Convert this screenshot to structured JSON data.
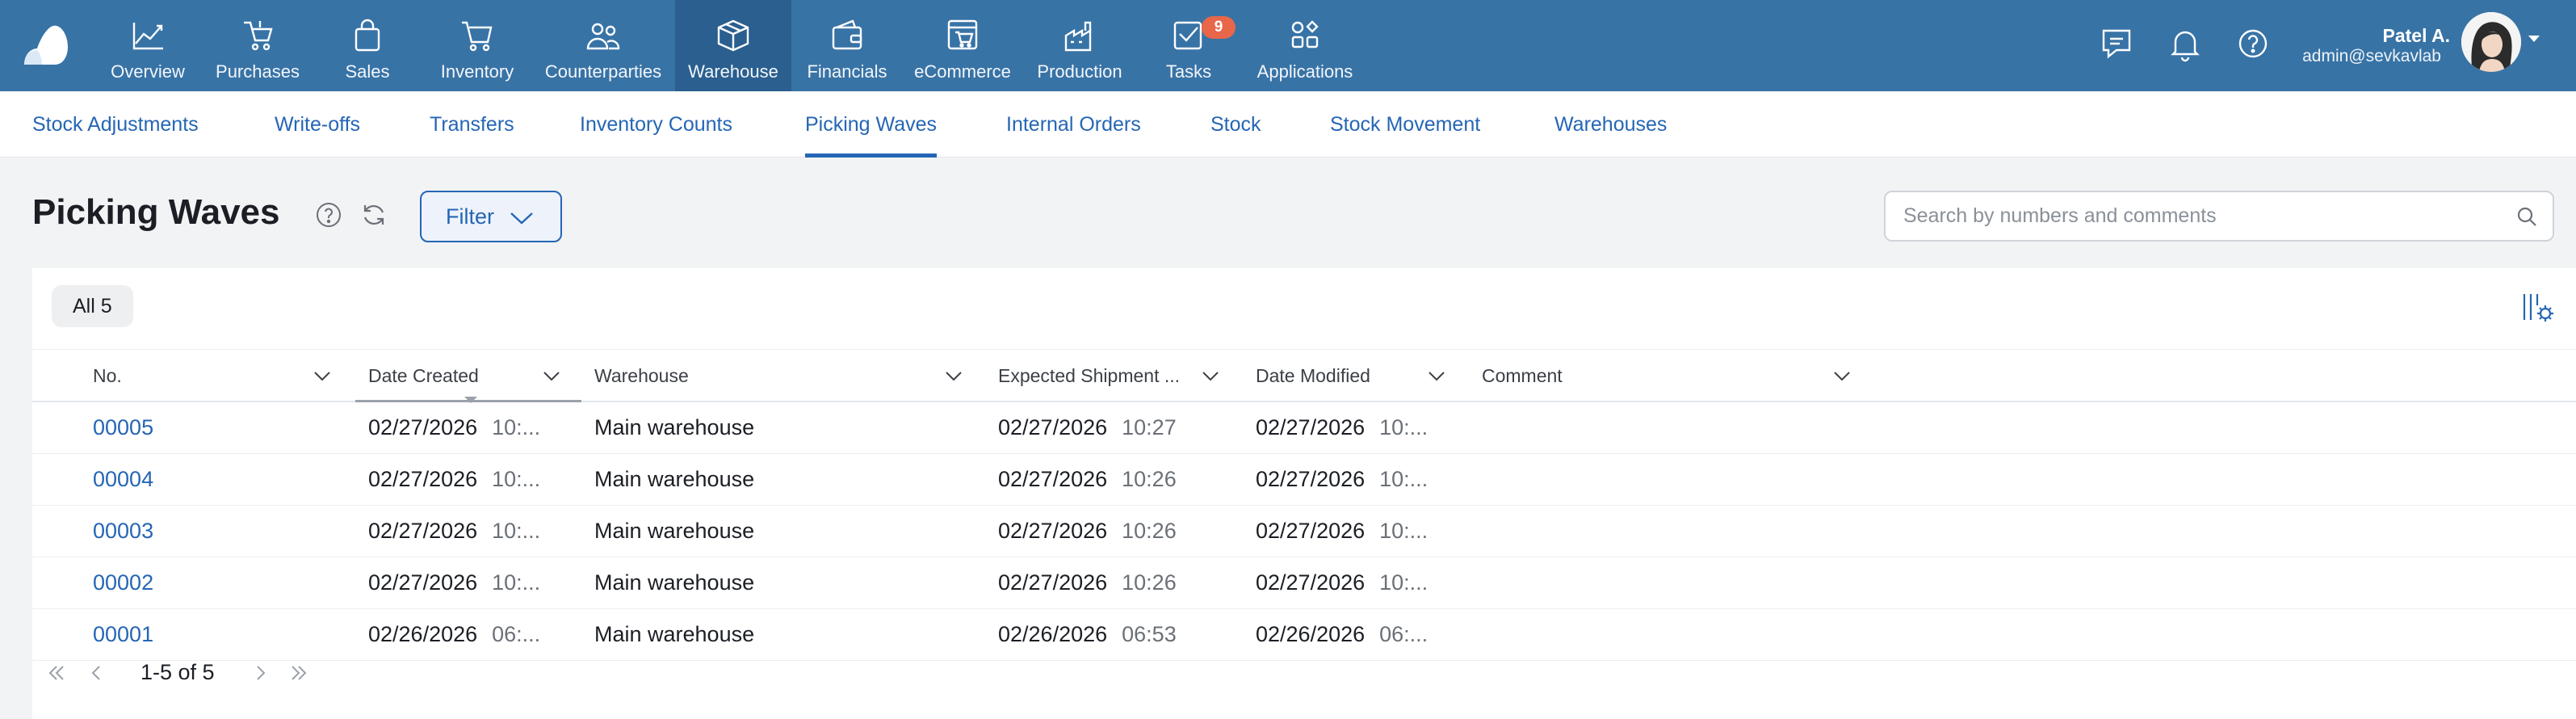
{
  "nav": {
    "items": [
      {
        "label": "Overview",
        "icon": "chart-line-icon"
      },
      {
        "label": "Purchases",
        "icon": "basket-icon"
      },
      {
        "label": "Sales",
        "icon": "shopping-bag-icon"
      },
      {
        "label": "Inventory",
        "icon": "cart-icon"
      },
      {
        "label": "Counterparties",
        "icon": "people-icon"
      },
      {
        "label": "Warehouse",
        "icon": "box-icon",
        "active": true
      },
      {
        "label": "Financials",
        "icon": "wallet-icon"
      },
      {
        "label": "eCommerce",
        "icon": "store-icon"
      },
      {
        "label": "Production",
        "icon": "factory-icon"
      },
      {
        "label": "Tasks",
        "icon": "checkbox-icon",
        "badge": "9"
      },
      {
        "label": "Applications",
        "icon": "apps-icon"
      }
    ],
    "accent_color": "#3873a6",
    "badge_color": "#e8664a"
  },
  "user": {
    "name": "Patel A.",
    "email": "admin@sevkavlab"
  },
  "subnav": {
    "tabs": [
      {
        "label": "Stock Adjustments"
      },
      {
        "label": "Write-offs"
      },
      {
        "label": "Transfers"
      },
      {
        "label": "Inventory Counts"
      },
      {
        "label": "Picking Waves",
        "active": true
      },
      {
        "label": "Internal Orders"
      },
      {
        "label": "Stock"
      },
      {
        "label": "Stock Movement"
      },
      {
        "label": "Warehouses"
      }
    ]
  },
  "page": {
    "title": "Picking Waves",
    "filter_label": "Filter",
    "search_placeholder": "Search by numbers and comments",
    "chip_label": "All 5"
  },
  "table": {
    "columns": [
      {
        "label": "No."
      },
      {
        "label": "Date Created",
        "sorted": true
      },
      {
        "label": "Warehouse"
      },
      {
        "label": "Expected Shipment ..."
      },
      {
        "label": "Date Modified"
      },
      {
        "label": "Comment"
      }
    ],
    "rows": [
      {
        "no": "00005",
        "created_date": "02/27/2026",
        "created_time": "10:...",
        "warehouse": "Main warehouse",
        "ship_date": "02/27/2026",
        "ship_time": "10:27",
        "mod_date": "02/27/2026",
        "mod_time": "10:...",
        "comment": ""
      },
      {
        "no": "00004",
        "created_date": "02/27/2026",
        "created_time": "10:...",
        "warehouse": "Main warehouse",
        "ship_date": "02/27/2026",
        "ship_time": "10:26",
        "mod_date": "02/27/2026",
        "mod_time": "10:...",
        "comment": ""
      },
      {
        "no": "00003",
        "created_date": "02/27/2026",
        "created_time": "10:...",
        "warehouse": "Main warehouse",
        "ship_date": "02/27/2026",
        "ship_time": "10:26",
        "mod_date": "02/27/2026",
        "mod_time": "10:...",
        "comment": ""
      },
      {
        "no": "00002",
        "created_date": "02/27/2026",
        "created_time": "10:...",
        "warehouse": "Main warehouse",
        "ship_date": "02/27/2026",
        "ship_time": "10:26",
        "mod_date": "02/27/2026",
        "mod_time": "10:...",
        "comment": ""
      },
      {
        "no": "00001",
        "created_date": "02/26/2026",
        "created_time": "06:...",
        "warehouse": "Main warehouse",
        "ship_date": "02/26/2026",
        "ship_time": "06:53",
        "mod_date": "02/26/2026",
        "mod_time": "06:...",
        "comment": ""
      }
    ]
  },
  "pager": {
    "range": "1-5 of 5"
  }
}
